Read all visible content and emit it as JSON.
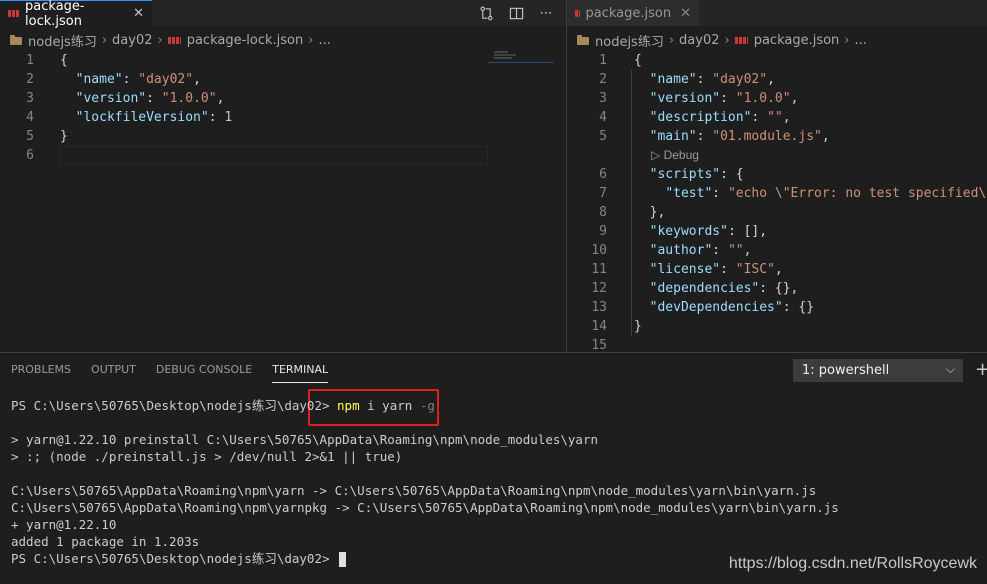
{
  "left_editor": {
    "tab": {
      "label": "package-lock.json",
      "close": "✕"
    },
    "actions": {
      "compare_icon": "compare-icon",
      "split_icon": "split-editor-icon",
      "more": "⋯"
    },
    "breadcrumb": {
      "folder": "nodejs练习",
      "subfolder": "day02",
      "file": "package-lock.json",
      "more": "..."
    },
    "line_numbers": [
      "1",
      "2",
      "3",
      "4",
      "5",
      "6"
    ]
  },
  "right_editor": {
    "tab": {
      "label": "package.json",
      "close": "✕"
    },
    "breadcrumb": {
      "folder": "nodejs练习",
      "subfolder": "day02",
      "file": "package.json",
      "more": "..."
    },
    "codelens": "▷ Debug",
    "line_numbers": [
      "1",
      "2",
      "3",
      "4",
      "5",
      "6",
      "7",
      "8",
      "9",
      "10",
      "11",
      "12",
      "13",
      "14",
      "15"
    ]
  },
  "panel": {
    "tabs": [
      "PROBLEMS",
      "OUTPUT",
      "DEBUG CONSOLE",
      "TERMINAL"
    ],
    "active_tab": "TERMINAL",
    "terminal_select": "1: powershell",
    "add_button": "+"
  },
  "terminal": {
    "prompt1": "PS C:\\Users\\50765\\Desktop\\nodejs练习\\day02> ",
    "cmd_npm": "npm",
    "cmd_args": " i yarn ",
    "cmd_flag": "-g",
    "out1": "> yarn@1.22.10 preinstall C:\\Users\\50765\\AppData\\Roaming\\npm\\node_modules\\yarn",
    "out2": "> :; (node ./preinstall.js > /dev/null 2>&1 || true)",
    "out3": "C:\\Users\\50765\\AppData\\Roaming\\npm\\yarn -> C:\\Users\\50765\\AppData\\Roaming\\npm\\node_modules\\yarn\\bin\\yarn.js",
    "out4": "C:\\Users\\50765\\AppData\\Roaming\\npm\\yarnpkg -> C:\\Users\\50765\\AppData\\Roaming\\npm\\node_modules\\yarn\\bin\\yarn.js",
    "out5": "+ yarn@1.22.10",
    "out6": "added 1 package in 1.203s",
    "prompt2": "PS C:\\Users\\50765\\Desktop\\nodejs练习\\day02> "
  },
  "watermark": "https://blog.csdn.net/RollsRoycewk",
  "colors": {
    "key": "#9cdcfe",
    "string": "#ce9178",
    "number": "#b5cea8",
    "highlight_box": "#e02020"
  }
}
